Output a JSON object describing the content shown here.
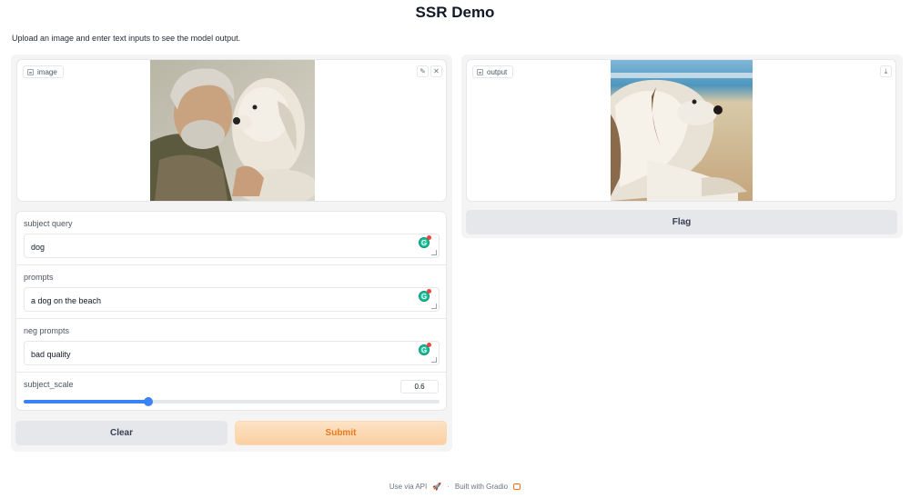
{
  "header": {
    "title": "SSR Demo",
    "description": "Upload an image and enter text inputs to see the model output."
  },
  "input_image": {
    "label": "image",
    "icon": "image-icon",
    "edit_icon": "pencil-icon",
    "clear_icon": "close-icon"
  },
  "output_image": {
    "label": "output",
    "icon": "image-icon",
    "download_icon": "download-icon"
  },
  "fields": {
    "subject_query": {
      "label": "subject query",
      "value": "dog"
    },
    "prompts": {
      "label": "prompts",
      "value": "a dog on the beach"
    },
    "neg_prompts": {
      "label": "neg prompts",
      "value": "bad quality"
    }
  },
  "slider": {
    "label": "subject_scale",
    "value": "0.6",
    "fraction": 0.3
  },
  "buttons": {
    "clear": "Clear",
    "submit": "Submit",
    "flag": "Flag"
  },
  "footer": {
    "api": "Use via API",
    "separator": "·",
    "built": "Built with Gradio"
  },
  "colors": {
    "accent": "#3b82f6",
    "submit_text": "#ea7a1d",
    "grammarly": "#15c39a"
  }
}
